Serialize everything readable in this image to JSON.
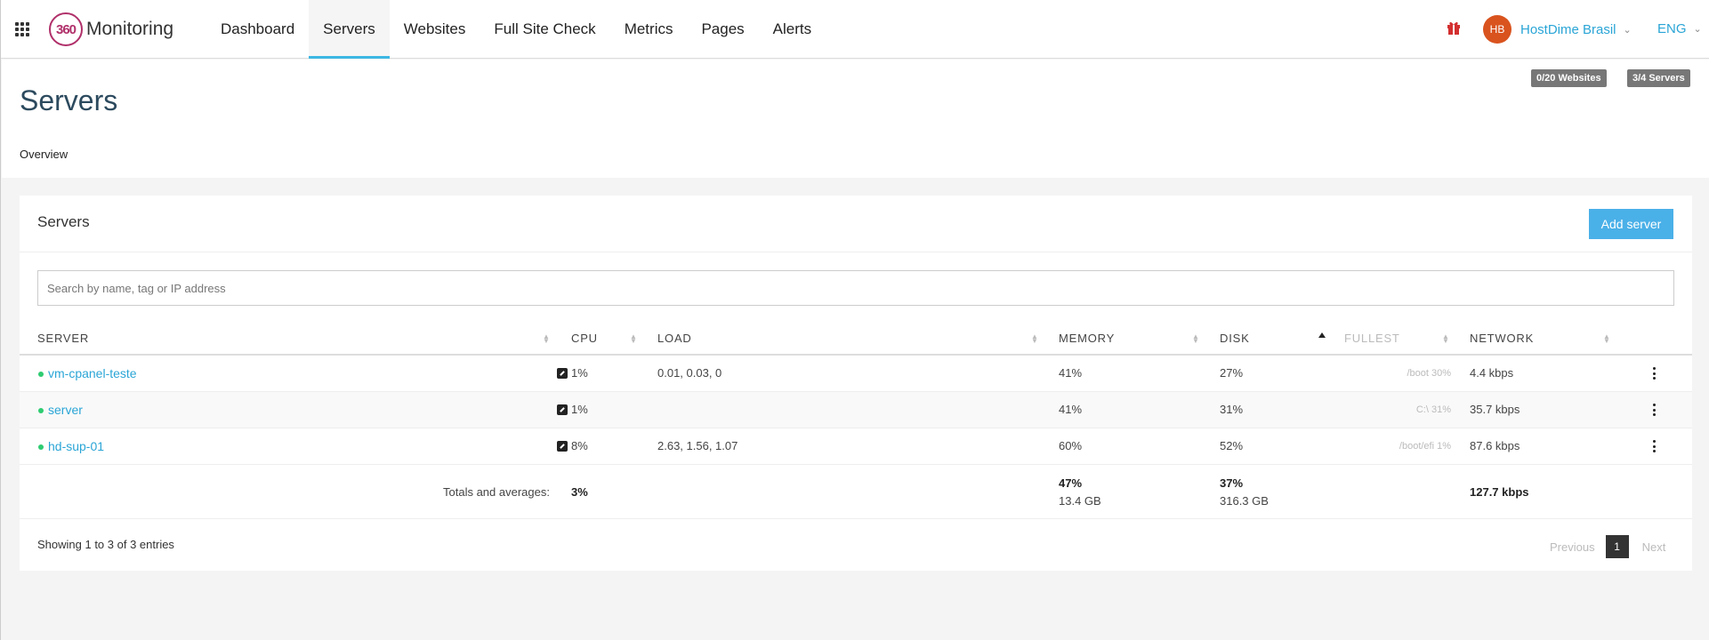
{
  "nav": {
    "logo_badge": "360",
    "logo_text": "Monitoring",
    "items": [
      {
        "label": "Dashboard",
        "active": false
      },
      {
        "label": "Servers",
        "active": true
      },
      {
        "label": "Websites",
        "active": false
      },
      {
        "label": "Full Site Check",
        "active": false
      },
      {
        "label": "Metrics",
        "active": false
      },
      {
        "label": "Pages",
        "active": false
      },
      {
        "label": "Alerts",
        "active": false
      }
    ],
    "user_initials": "HB",
    "user_name": "HostDime Brasil",
    "language": "ENG",
    "icons": [
      "apps-grid-icon",
      "gift-icon",
      "chevron-down-icon"
    ]
  },
  "header": {
    "quota_websites": "0/20 Websites",
    "quota_servers": "3/4 Servers",
    "title": "Servers",
    "breadcrumb": "Overview"
  },
  "panel": {
    "title": "Servers",
    "add_button": "Add server",
    "search_placeholder": "Search by name, tag or IP address"
  },
  "table": {
    "columns": [
      "SERVER",
      "CPU",
      "LOAD",
      "MEMORY",
      "DISK",
      "FULLEST",
      "NETWORK"
    ],
    "rows": [
      {
        "server": "vm-cpanel-teste",
        "status": "online",
        "cpu": "1%",
        "load": "0.01, 0.03, 0",
        "memory": "41%",
        "disk": "27%",
        "fullest": "/boot 30%",
        "network": "4.4 kbps"
      },
      {
        "server": "server",
        "status": "online",
        "cpu": "1%",
        "load": "",
        "memory": "41%",
        "disk": "31%",
        "fullest": "C:\\ 31%",
        "network": "35.7 kbps"
      },
      {
        "server": "hd-sup-01",
        "status": "online",
        "cpu": "8%",
        "load": "2.63, 1.56, 1.07",
        "memory": "60%",
        "disk": "52%",
        "fullest": "/boot/efi 1%",
        "network": "87.6 kbps"
      }
    ],
    "totals": {
      "label": "Totals and averages:",
      "cpu": "3%",
      "memory_pct": "47%",
      "memory_size": "13.4 GB",
      "disk_pct": "37%",
      "disk_size": "316.3 GB",
      "network": "127.7 kbps"
    }
  },
  "footer": {
    "showing": "Showing 1 to 3 of 3 entries",
    "previous": "Previous",
    "page": "1",
    "next": "Next"
  },
  "colors": {
    "accent": "#3cb7e3",
    "link": "#2aa5d6",
    "status_online": "#2ecc71",
    "avatar": "#d9531e",
    "logo": "#b0306a"
  }
}
